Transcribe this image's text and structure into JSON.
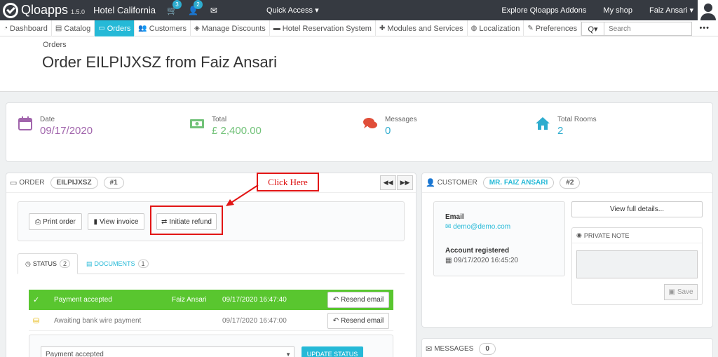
{
  "topbar": {
    "brand": "Qloapps",
    "version": "1.5.0",
    "shop_name": "Hotel California",
    "cart_count": "3",
    "customers_count": "2",
    "quick_access": "Quick Access ▾",
    "explore": "Explore Qloapps Addons",
    "my_shop": "My shop",
    "user": "Faiz Ansari ▾"
  },
  "nav": {
    "items": [
      {
        "label": "Dashboard",
        "icon": "dashboard-icon",
        "glyph": "◔"
      },
      {
        "label": "Catalog",
        "icon": "book-icon",
        "glyph": "▤"
      },
      {
        "label": "Orders",
        "icon": "credit-card-icon",
        "glyph": "▭"
      },
      {
        "label": "Customers",
        "icon": "users-icon",
        "glyph": "👥"
      },
      {
        "label": "Manage Discounts",
        "icon": "tag-icon",
        "glyph": "◈"
      },
      {
        "label": "Hotel Reservation System",
        "icon": "bed-icon",
        "glyph": "▬"
      },
      {
        "label": "Modules and Services",
        "icon": "puzzle-icon",
        "glyph": "✚"
      },
      {
        "label": "Localization",
        "icon": "globe-icon",
        "glyph": "◍"
      },
      {
        "label": "Preferences",
        "icon": "wrench-icon",
        "glyph": "✎"
      }
    ],
    "search_placeholder": "Search",
    "search_button": "Q▾",
    "more": "•••"
  },
  "header": {
    "breadcrumb": "Orders",
    "title": "Order EILPIJXSZ from Faiz Ansari"
  },
  "kpis": [
    {
      "label": "Date",
      "value": "09/17/2020",
      "color": "#a165ac",
      "icon": "calendar-icon"
    },
    {
      "label": "Total",
      "value": "£ 2,400.00",
      "color": "#72c279",
      "icon": "money-icon"
    },
    {
      "label": "Messages",
      "value": "0",
      "color": "#2eacce",
      "icon": "comments-icon"
    },
    {
      "label": "Total Rooms",
      "value": "2",
      "color": "#2eacce",
      "icon": "home-icon"
    }
  ],
  "order": {
    "heading": "ORDER",
    "reference": "EILPIJXSZ",
    "number": "#1",
    "buttons": {
      "print": "Print order",
      "invoice": "View invoice",
      "refund": "Initiate refund"
    },
    "callout": "Click Here",
    "tabs": {
      "status": "STATUS",
      "status_count": "2",
      "documents": "DOCUMENTS",
      "documents_count": "1"
    },
    "history": [
      {
        "status": "Payment accepted",
        "employee": "Faiz Ansari",
        "date": "09/17/2020 16:47:40",
        "action": "Resend email"
      },
      {
        "status": "Awaiting bank wire payment",
        "employee": "",
        "date": "09/17/2020 16:47:00",
        "action": "Resend email"
      }
    ],
    "status_select": "Payment accepted",
    "update_button": "UPDATE STATUS"
  },
  "customer": {
    "heading": "CUSTOMER",
    "name": "MR. FAIZ ANSARI",
    "number": "#2",
    "email_label": "Email",
    "email": "demo@demo.com",
    "registered_label": "Account registered",
    "registered": "09/17/2020 16:45:20",
    "view_full": "View full details...",
    "private_note": "PRIVATE NOTE",
    "save": "Save"
  },
  "messages": {
    "heading": "MESSAGES",
    "count": "0"
  }
}
